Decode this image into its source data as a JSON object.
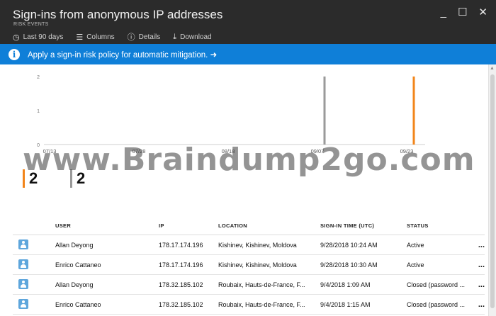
{
  "header": {
    "title": "Sign-ins from anonymous IP addresses",
    "subtitle": "RISK EVENTS",
    "minimize": "_",
    "maximize": "☐",
    "close": "✕"
  },
  "toolbar": {
    "items": [
      {
        "icon": "clock-icon",
        "glyph": "◷",
        "label": "Last 90 days"
      },
      {
        "icon": "columns-icon",
        "glyph": "☰",
        "label": "Columns"
      },
      {
        "icon": "info-icon",
        "glyph": "ⓘ",
        "label": "Details"
      },
      {
        "icon": "download-icon",
        "glyph": "⤓",
        "label": "Download"
      }
    ]
  },
  "banner": {
    "text": "Apply a sign-in risk policy for automatic mitigation. ➜"
  },
  "colors": {
    "header_bg": "#2b2b2b",
    "banner_bg": "#0f7fd8",
    "series_orange": "#f2851a",
    "series_gray": "#9a9a9a"
  },
  "chart_data": {
    "type": "bar",
    "y_ticks": [
      "0",
      "1",
      "2"
    ],
    "ylim": [
      0,
      2
    ],
    "x_ticks": [
      "07/13",
      "07/28",
      "08/18",
      "09/07",
      "09/23"
    ],
    "series": [
      {
        "color": "#f2851a",
        "points": [
          {
            "x": "09/23",
            "value": 2
          }
        ]
      },
      {
        "color": "#9a9a9a",
        "points": [
          {
            "x": "09/07",
            "value": 2
          }
        ]
      }
    ],
    "totals": [
      {
        "color": "#f2851a",
        "value": "2"
      },
      {
        "color": "#9a9a9a",
        "value": "2"
      }
    ]
  },
  "watermark": "www.Braindump2go.com",
  "table": {
    "headers": {
      "user": "USER",
      "ip": "IP",
      "location": "LOCATION",
      "time": "SIGN-IN TIME (UTC)",
      "status": "STATUS"
    },
    "rows": [
      {
        "user": "Allan Deyong",
        "ip": "178.17.174.196",
        "location": "Kishinev, Kishinev, Moldova",
        "time": "9/28/2018 10:24 AM",
        "status": "Active",
        "more": "..."
      },
      {
        "user": "Enrico Cattaneo",
        "ip": "178.17.174.196",
        "location": "Kishinev, Kishinev, Moldova",
        "time": "9/28/2018 10:30 AM",
        "status": "Active",
        "more": "..."
      },
      {
        "user": "Allan Deyong",
        "ip": "178.32.185.102",
        "location": "Roubaix, Hauts-de-France, F...",
        "time": "9/4/2018 1:09 AM",
        "status": "Closed (password ...",
        "more": "..."
      },
      {
        "user": "Enrico Cattaneo",
        "ip": "178.32.185.102",
        "location": "Roubaix, Hauts-de-France, F...",
        "time": "9/4/2018 1:15 AM",
        "status": "Closed (password ...",
        "more": "..."
      }
    ]
  }
}
